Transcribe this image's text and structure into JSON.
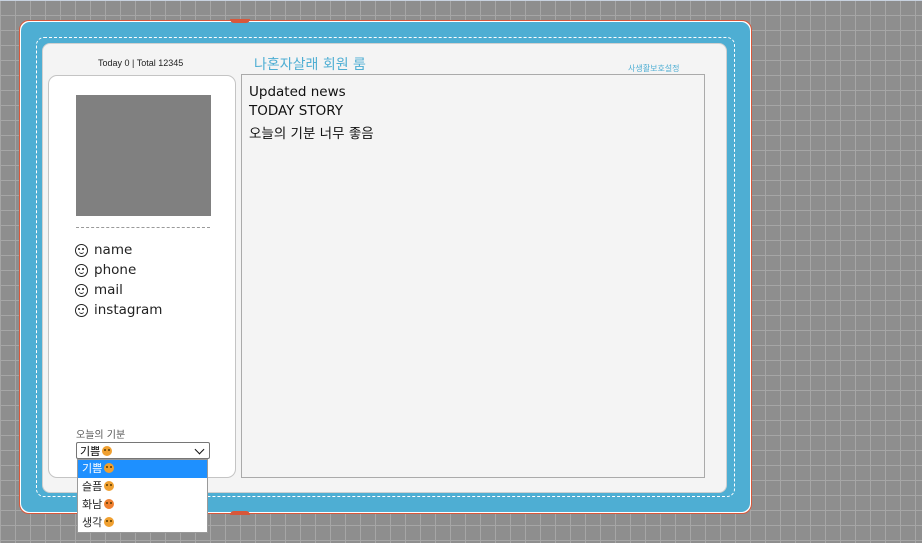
{
  "header": {
    "visitor_counter": "Today 0 | Total 12345",
    "room_title": "나혼자살래 회원 룸",
    "settings_link": "사생활보호설정"
  },
  "profile": {
    "info_items": [
      {
        "icon": "smiley-icon",
        "label": "name"
      },
      {
        "icon": "smiley-icon",
        "label": "phone"
      },
      {
        "icon": "smiley-icon",
        "label": "mail"
      },
      {
        "icon": "smiley-icon",
        "label": "instagram"
      }
    ],
    "mood": {
      "label": "오늘의 기분",
      "selected": "기쁨",
      "options": [
        {
          "label": "기쁨",
          "emoji_color": "#f0a030"
        },
        {
          "label": "슬픔",
          "emoji_color": "#f0a030"
        },
        {
          "label": "화남",
          "emoji_color": "#f08030"
        },
        {
          "label": "생각",
          "emoji_color": "#f0a030"
        }
      ]
    }
  },
  "content": {
    "updated_heading": "Updated news",
    "story_title": "TODAY STORY",
    "story_text": "오늘의 기분 너무 좋음"
  },
  "colors": {
    "cover": "#4eaed3",
    "accent_red": "#d8573a",
    "select_highlight": "#1e90ff"
  }
}
